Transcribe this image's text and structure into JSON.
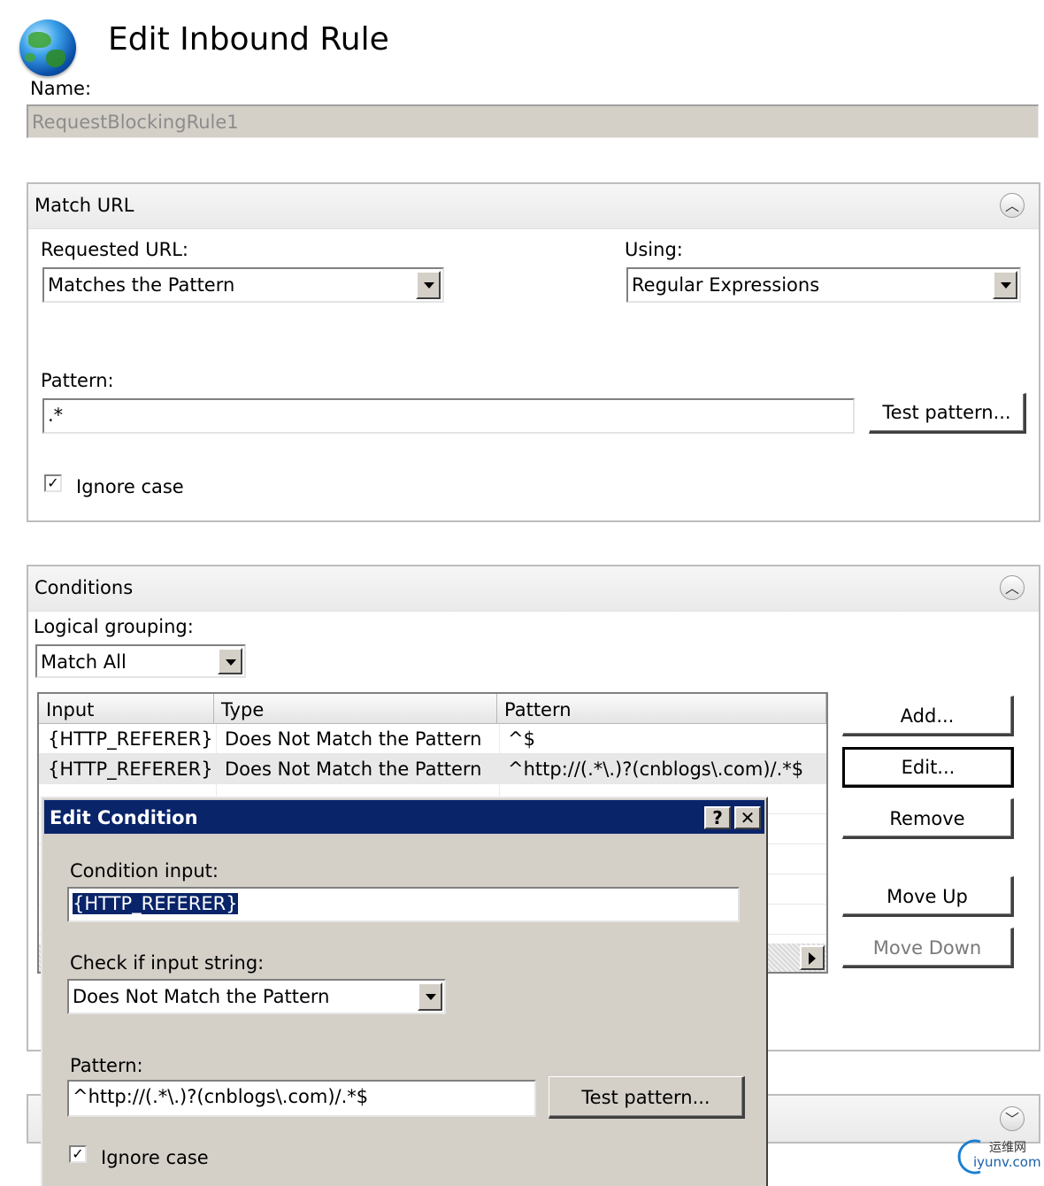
{
  "header": {
    "title": "Edit Inbound Rule",
    "icon": "globe-icon"
  },
  "name": {
    "label": "Name:",
    "value": "RequestBlockingRule1"
  },
  "match_url": {
    "title": "Match URL",
    "requested_url_label": "Requested URL:",
    "requested_url_value": "Matches the Pattern",
    "using_label": "Using:",
    "using_value": "Regular Expressions",
    "pattern_label": "Pattern:",
    "pattern_value": ".*",
    "test_pattern_button": "Test pattern...",
    "ignore_case_label": "Ignore case",
    "ignore_case_checked": true
  },
  "conditions": {
    "title": "Conditions",
    "logical_grouping_label": "Logical grouping:",
    "logical_grouping_value": "Match All",
    "columns": [
      "Input",
      "Type",
      "Pattern"
    ],
    "rows": [
      {
        "input": "{HTTP_REFERER}",
        "type": "Does Not Match the Pattern",
        "pattern": "^$"
      },
      {
        "input": "{HTTP_REFERER}",
        "type": "Does Not Match the Pattern",
        "pattern": "^http://(.*\\.)?(cnblogs\\.com)/.*$"
      }
    ],
    "buttons": {
      "add": "Add...",
      "edit": "Edit...",
      "remove": "Remove",
      "move_up": "Move Up",
      "move_down": "Move Down"
    }
  },
  "dialog": {
    "title": "Edit Condition",
    "help_button": "?",
    "close_button": "✕",
    "condition_input_label": "Condition input:",
    "condition_input_value": "{HTTP_REFERER}",
    "check_label": "Check if input string:",
    "check_value": "Does Not Match the Pattern",
    "pattern_label": "Pattern:",
    "pattern_value": "^http://(.*\\.)?(cnblogs\\.com)/.*$",
    "test_pattern_button": "Test pattern...",
    "ignore_case_label": "Ignore case",
    "ignore_case_checked": true
  },
  "watermark": {
    "line1": "运维网",
    "line2": "iyunv.com"
  },
  "colors": {
    "dialog_title_bar": "#0a246a",
    "dialog_face": "#d4d0c8",
    "readonly_field": "#d4d0c8"
  }
}
